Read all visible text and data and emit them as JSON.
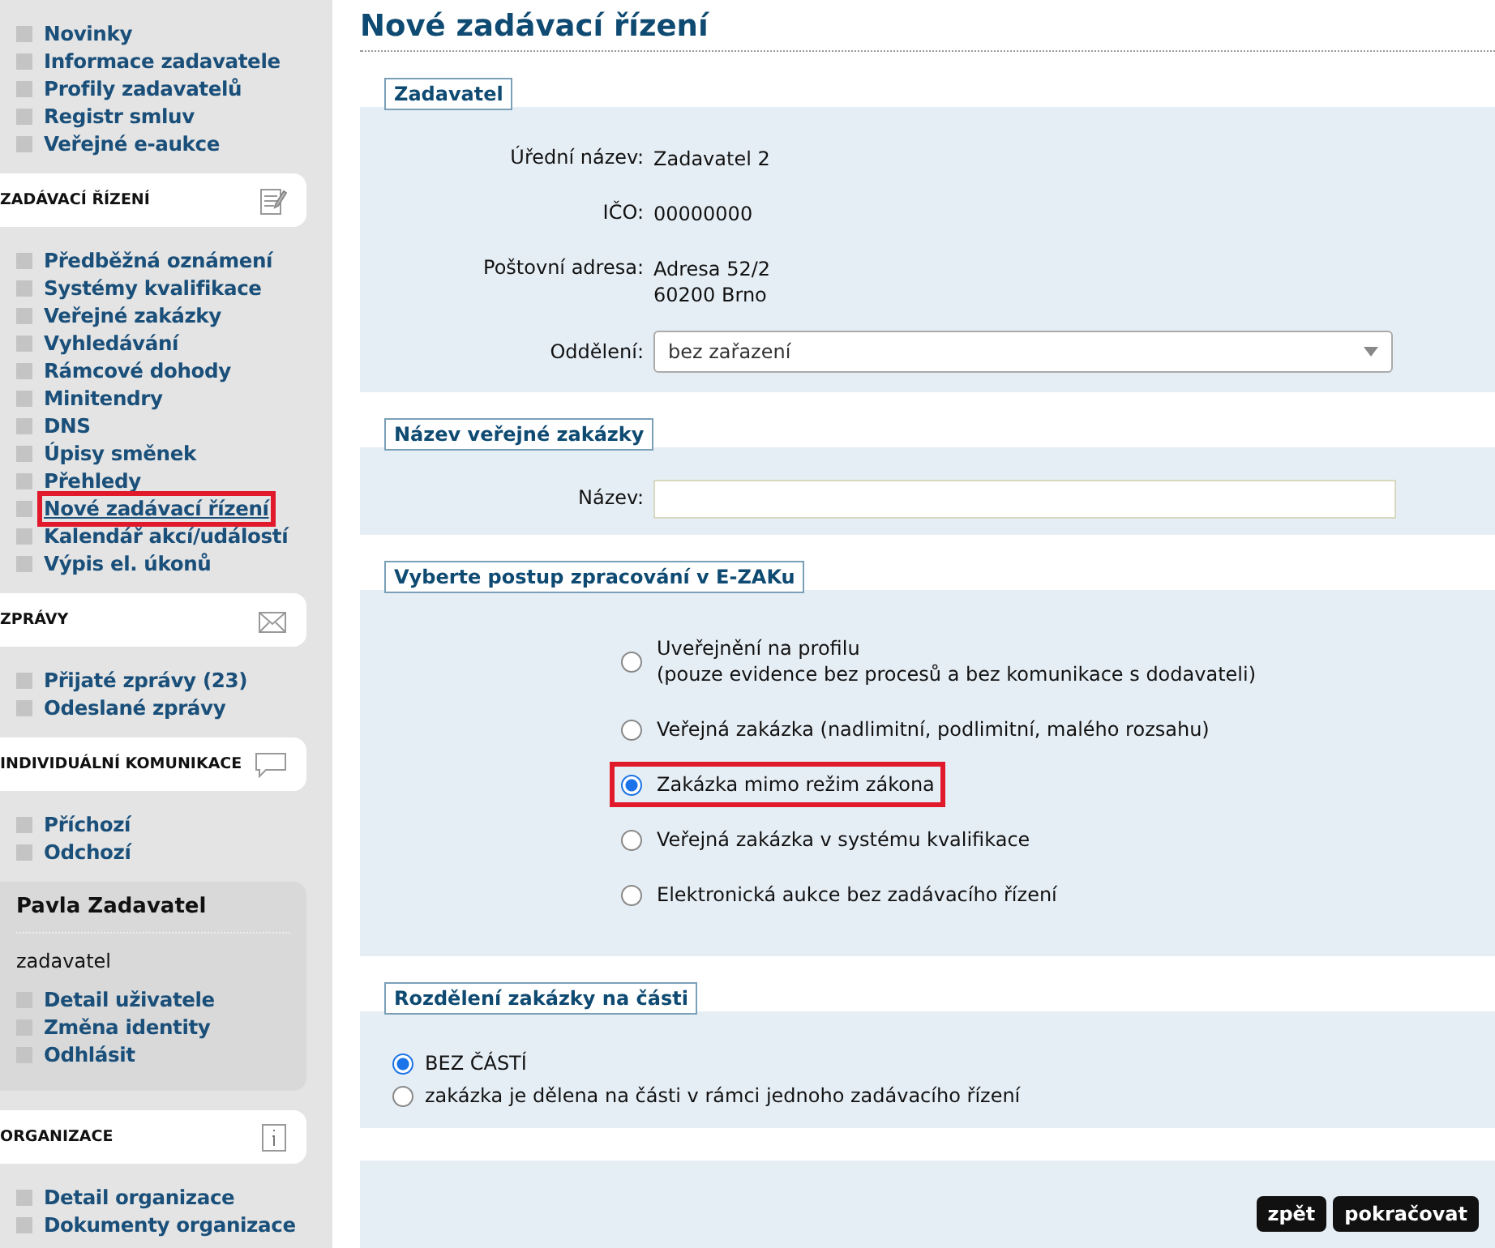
{
  "sidebar": [
    {
      "kind": "links",
      "items": [
        {
          "label": "Novinky",
          "selected": false,
          "highlighted": false
        },
        {
          "label": "Informace zadavatele",
          "selected": false,
          "highlighted": false
        },
        {
          "label": "Profily zadavatelů",
          "selected": false,
          "highlighted": false
        },
        {
          "label": "Registr smluv",
          "selected": false,
          "highlighted": false
        },
        {
          "label": "Veřejné e-aukce",
          "selected": false,
          "highlighted": false
        }
      ]
    },
    {
      "kind": "heading",
      "label": "ZADÁVACÍ ŘÍZENÍ"
    },
    {
      "kind": "links",
      "items": [
        {
          "label": "Předběžná oznámení",
          "selected": false,
          "highlighted": false
        },
        {
          "label": "Systémy kvalifikace",
          "selected": false,
          "highlighted": false
        },
        {
          "label": "Veřejné zakázky",
          "selected": false,
          "highlighted": false
        },
        {
          "label": "Vyhledávání",
          "selected": false,
          "highlighted": false
        },
        {
          "label": "Rámcové dohody",
          "selected": false,
          "highlighted": false
        },
        {
          "label": "Minitendry",
          "selected": false,
          "highlighted": false
        },
        {
          "label": "DNS",
          "selected": false,
          "highlighted": false
        },
        {
          "label": "Úpisy směnek",
          "selected": false,
          "highlighted": false
        },
        {
          "label": "Přehledy",
          "selected": false,
          "highlighted": false
        },
        {
          "label": "Nové zadávací řízení",
          "selected": true,
          "highlighted": true
        },
        {
          "label": "Kalendář akcí/událostí",
          "selected": false,
          "highlighted": false
        },
        {
          "label": "Výpis el. úkonů",
          "selected": false,
          "highlighted": false
        }
      ]
    },
    {
      "kind": "heading",
      "label": "ZPRÁVY"
    },
    {
      "kind": "links",
      "items": [
        {
          "label": "Přijaté zprávy (23)",
          "selected": false,
          "highlighted": false
        },
        {
          "label": "Odeslané zprávy",
          "selected": false,
          "highlighted": false
        }
      ]
    },
    {
      "kind": "heading",
      "label": "INDIVIDUÁLNÍ KOMUNIKACE"
    },
    {
      "kind": "links",
      "items": [
        {
          "label": "Příchozí",
          "selected": false,
          "highlighted": false
        },
        {
          "label": "Odchozí",
          "selected": false,
          "highlighted": false
        }
      ]
    },
    {
      "kind": "user",
      "name": "Pavla Zadavatel",
      "role": "zadavatel",
      "items": [
        {
          "label": "Detail uživatele",
          "selected": false,
          "highlighted": false
        },
        {
          "label": "Změna identity",
          "selected": false,
          "highlighted": false
        },
        {
          "label": "Odhlásit",
          "selected": false,
          "highlighted": false
        }
      ]
    },
    {
      "kind": "heading",
      "label": "ORGANIZACE"
    },
    {
      "kind": "links",
      "items": [
        {
          "label": "Detail organizace",
          "selected": false,
          "highlighted": false
        },
        {
          "label": "Dokumenty organizace",
          "selected": false,
          "highlighted": false
        }
      ]
    }
  ],
  "title": "Nové zadávací řízení",
  "contracting_authority": {
    "legend": "Zadavatel",
    "fields": [
      {
        "label": "Úřední název:",
        "lines": [
          "Zadavatel 2"
        ]
      },
      {
        "label": "IČO:",
        "lines": [
          "00000000"
        ]
      },
      {
        "label": "Poštovní adresa:",
        "lines": [
          "Adresa 52/2",
          "60200 Brno"
        ]
      }
    ],
    "department": {
      "label": "Oddělení:",
      "value": "bez zařazení"
    }
  },
  "contract_name": {
    "legend": "Název veřejné zakázky",
    "label": "Název:"
  },
  "procedure": {
    "legend": "Vyberte postup zpracování v E-ZAKu",
    "options": [
      {
        "lines": [
          "Uveřejnění na profilu",
          "(pouze evidence bez procesů a bez komunikace s dodavateli)"
        ],
        "selected": false,
        "highlighted": false
      },
      {
        "lines": [
          "Veřejná zakázka (nadlimitní, podlimitní, malého rozsahu)"
        ],
        "selected": false,
        "highlighted": false
      },
      {
        "lines": [
          "Zakázka mimo režim zákona"
        ],
        "selected": true,
        "highlighted": true
      },
      {
        "lines": [
          "Veřejná zakázka v systému kvalifikace"
        ],
        "selected": false,
        "highlighted": false
      },
      {
        "lines": [
          "Elektronická aukce bez zadávacího řízení"
        ],
        "selected": false,
        "highlighted": false
      }
    ]
  },
  "parts": {
    "legend": "Rozdělení zakázky na části",
    "options": [
      {
        "label": "BEZ ČÁSTÍ",
        "selected": true
      },
      {
        "label": "zakázka je dělena na části v rámci jednoho zadávacího řízení",
        "selected": false
      }
    ]
  },
  "buttons": [
    "zpět",
    "pokračovat"
  ]
}
